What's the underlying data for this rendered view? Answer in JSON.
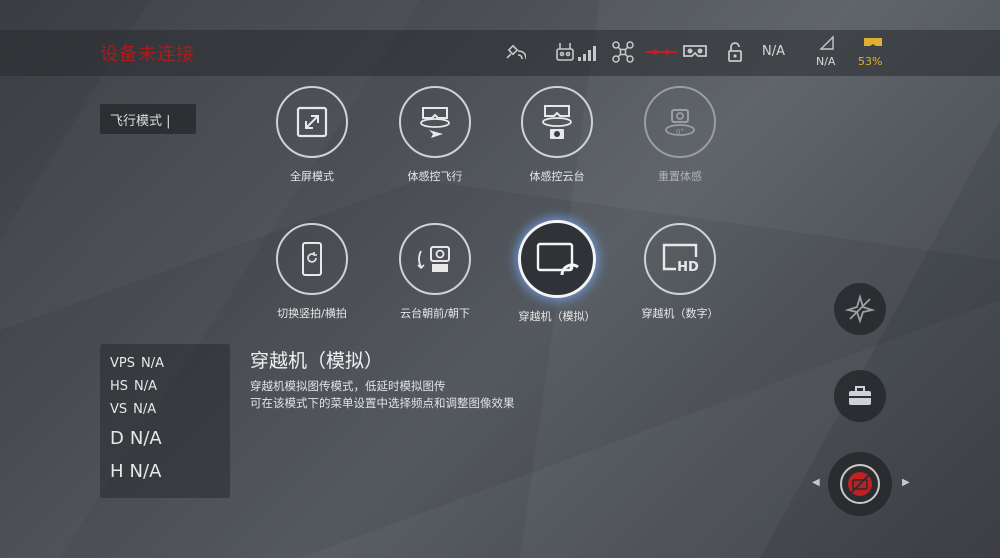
{
  "header": {
    "title": "设备未连接",
    "status_na_1": "N/A",
    "status_na_2": "N/A",
    "battery": "53%"
  },
  "mode_tag": "飞行模式 |",
  "tiles": [
    {
      "label": "全屏模式",
      "icon": "fullscreen-icon",
      "state": "normal"
    },
    {
      "label": "体感控飞行",
      "icon": "motion-flight-icon",
      "state": "normal"
    },
    {
      "label": "体感控云台",
      "icon": "motion-gimbal-icon",
      "state": "normal"
    },
    {
      "label": "重置体感",
      "icon": "reset-motion-icon",
      "state": "disabled"
    },
    {
      "label": "切换竖拍/横拍",
      "icon": "rotate-orientation-icon",
      "state": "normal"
    },
    {
      "label": "云台朝前/朝下",
      "icon": "gimbal-direction-icon",
      "state": "normal"
    },
    {
      "label": "穿越机（模拟）",
      "icon": "fpv-analog-icon",
      "state": "selected"
    },
    {
      "label": "穿越机（数字）",
      "icon": "fpv-hd-icon",
      "state": "normal"
    }
  ],
  "info": {
    "title": "穿越机（模拟）",
    "line1": "穿越机模拟图传模式，低延时模拟图传",
    "line2": "可在该模式下的菜单设置中选择频点和调整图像效果"
  },
  "telemetry": [
    {
      "key": "VPS",
      "value": "N/A"
    },
    {
      "key": "HS",
      "value": "N/A"
    },
    {
      "key": "VS",
      "value": "N/A"
    },
    {
      "key": "D",
      "value": "N/A"
    },
    {
      "key": "H",
      "value": "N/A"
    }
  ],
  "colors": {
    "title_red": "#b01a1a",
    "battery_yellow": "#e0b030",
    "record_red": "#c02020",
    "selected_glow": "#78aaff"
  }
}
